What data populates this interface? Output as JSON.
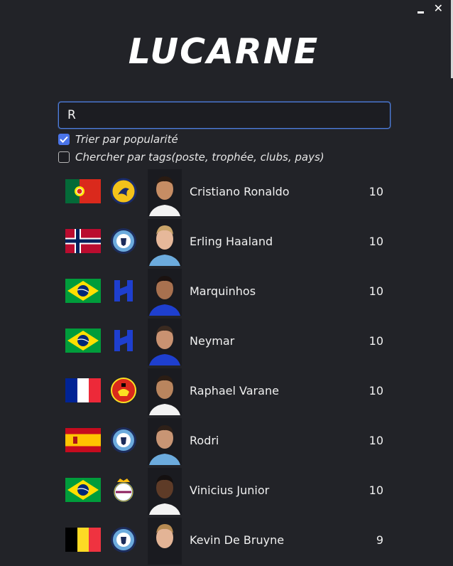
{
  "window": {
    "minimize_label": "minimize",
    "close_label": "✕"
  },
  "app": {
    "title": "LUCARNE"
  },
  "search": {
    "value": "R"
  },
  "options": {
    "sort_popularity": {
      "label": "Trier par popularité",
      "checked": true
    },
    "search_tags": {
      "label": "Chercher par tags(poste, trophée, clubs, pays)",
      "checked": false
    }
  },
  "players": [
    {
      "name": "Cristiano Ronaldo",
      "score": "10",
      "flag": "portugal",
      "club": "al-nassr"
    },
    {
      "name": "Erling Haaland",
      "score": "10",
      "flag": "norway",
      "club": "manchester-city"
    },
    {
      "name": "Marquinhos",
      "score": "10",
      "flag": "brazil",
      "club": "al-hilal"
    },
    {
      "name": "Neymar",
      "score": "10",
      "flag": "brazil",
      "club": "al-hilal"
    },
    {
      "name": "Raphael Varane",
      "score": "10",
      "flag": "france",
      "club": "manchester-united"
    },
    {
      "name": "Rodri",
      "score": "10",
      "flag": "spain",
      "club": "manchester-city"
    },
    {
      "name": "Vinicius Junior",
      "score": "10",
      "flag": "brazil",
      "club": "real-madrid"
    },
    {
      "name": "Kevin De Bruyne",
      "score": "9",
      "flag": "belgium",
      "club": "manchester-city"
    }
  ],
  "colors": {
    "background": "#222328",
    "accent": "#4a74e8"
  }
}
